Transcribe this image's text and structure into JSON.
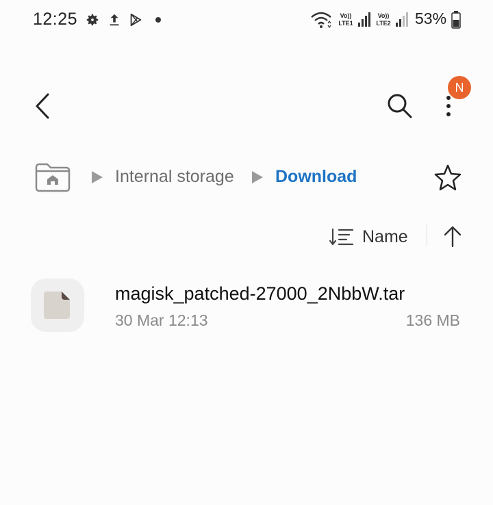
{
  "status_bar": {
    "time": "12:25",
    "network_1_top": "Vo))",
    "network_1_bottom": "LTE1",
    "network_2_top": "Vo))",
    "network_2_bottom": "LTE2",
    "battery": "53%",
    "left_icons": [
      "gear-icon",
      "upload-icon",
      "play-store-icon",
      "dot"
    ],
    "right_icons": [
      "wifi-icon",
      "signal-icon",
      "signal-icon",
      "battery-icon"
    ]
  },
  "app_bar": {
    "notification_badge": "N",
    "badge_color": "#e8642c"
  },
  "breadcrumb": {
    "items": [
      "Internal storage",
      "Download"
    ],
    "active_color": "#1f74c4"
  },
  "sort": {
    "label": "Name"
  },
  "files": [
    {
      "name": "magisk_patched-27000_2NbbW.tar",
      "date": "30 Mar 12:13",
      "size": "136 MB"
    }
  ]
}
